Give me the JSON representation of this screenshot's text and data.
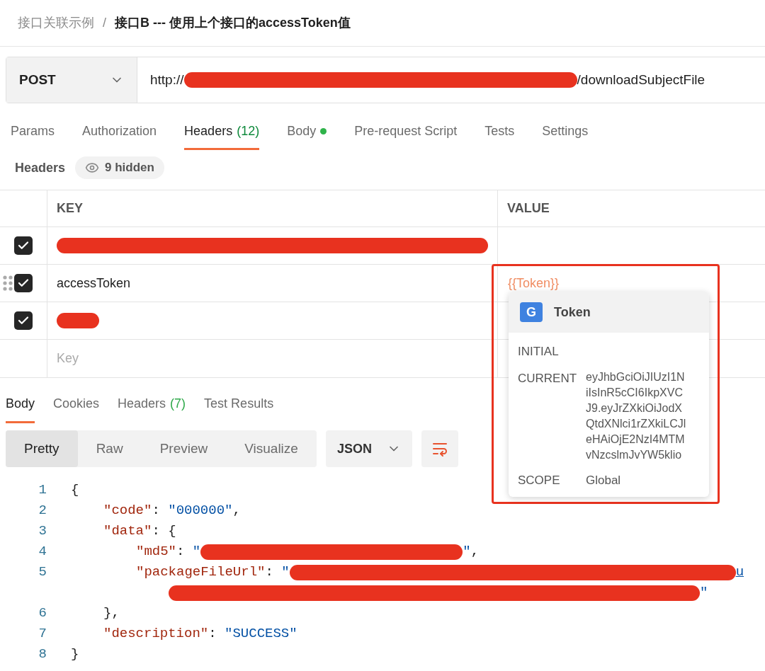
{
  "breadcrumb": {
    "parent": "接口关联示例",
    "separator": "/",
    "current": "接口B --- 使用上个接口的accessToken值"
  },
  "request": {
    "method": "POST",
    "url_prefix": "http://",
    "url_suffix": "/downloadSubjectFile"
  },
  "tabs": [
    {
      "label": "Params",
      "selected": false
    },
    {
      "label": "Authorization",
      "selected": false
    },
    {
      "label": "Headers",
      "badge": "(12)",
      "selected": true
    },
    {
      "label": "Body",
      "dot": true,
      "selected": false
    },
    {
      "label": "Pre-request Script",
      "selected": false
    },
    {
      "label": "Tests",
      "selected": false
    },
    {
      "label": "Settings",
      "selected": false
    }
  ],
  "headers_bar": {
    "title": "Headers",
    "hidden_badge": "9 hidden"
  },
  "table": {
    "columns": [
      "KEY",
      "VALUE"
    ],
    "rows": [
      {
        "kind": "masked",
        "checked": true
      },
      {
        "kind": "variable",
        "checked": true,
        "drag_handle": true,
        "key": "accessToken",
        "value": "{{Token}}"
      },
      {
        "kind": "masked",
        "checked": true
      },
      {
        "kind": "new",
        "placeholder": "Key"
      }
    ]
  },
  "popover": {
    "badge": "G",
    "name": "Token",
    "fields": [
      {
        "label": "INITIAL"
      },
      {
        "label": "CURRENT",
        "lines": [
          "eyJhbGciOiJIUzI1N",
          "iIsInR5cCI6IkpXVC",
          "J9.eyJrZXkiOiJodX",
          "QtdXNlci1rZXkiLCJl",
          "eHAiOjE2NzI4MTM",
          "vNzcslmJvYW5klio"
        ]
      },
      {
        "label": "SCOPE",
        "value": "Global"
      }
    ]
  },
  "response": {
    "tabs": [
      {
        "label": "Body",
        "selected": true
      },
      {
        "label": "Cookies",
        "selected": false
      },
      {
        "label": "Headers",
        "badge": "(7)",
        "selected": false
      },
      {
        "label": "Test Results",
        "selected": false
      }
    ],
    "view_modes": [
      {
        "label": "Pretty",
        "selected": true
      },
      {
        "label": "Raw",
        "selected": false
      },
      {
        "label": "Preview",
        "selected": false
      },
      {
        "label": "Visualize",
        "selected": false
      }
    ],
    "format": "JSON",
    "code": [
      {
        "number": "1",
        "kind": "outer",
        "tokens": [
          {
            "kind": "punct",
            "text": "{"
          }
        ]
      },
      {
        "number": "2",
        "kind": "inner",
        "tokens": [
          {
            "kind": "key",
            "text": "\"code\""
          },
          {
            "kind": "punct",
            "text": ": "
          },
          {
            "kind": "string",
            "text": "\"000000\""
          },
          {
            "kind": "punct",
            "text": ","
          }
        ]
      },
      {
        "number": "3",
        "kind": "inner",
        "tokens": [
          {
            "kind": "key",
            "text": "\"data\""
          },
          {
            "kind": "punct",
            "text": ": {"
          }
        ]
      },
      {
        "number": "4",
        "kind": "nested",
        "tokens": [
          {
            "kind": "key",
            "text": "\"md5\""
          },
          {
            "kind": "punct",
            "text": ": "
          },
          {
            "kind": "string",
            "text": "\""
          },
          {
            "kind": "mask"
          },
          {
            "kind": "string",
            "text": "\""
          },
          {
            "kind": "punct",
            "text": ","
          }
        ]
      },
      {
        "number": "5",
        "kind": "nested",
        "tokens": [
          {
            "kind": "key",
            "text": "\"packageFileUrl\""
          },
          {
            "kind": "punct",
            "text": ": "
          },
          {
            "kind": "string",
            "text": "\""
          },
          {
            "kind": "mask"
          },
          {
            "kind": "link",
            "text": "u"
          }
        ]
      },
      {
        "kind": "wrapped",
        "tokens": [
          {
            "kind": "mask"
          },
          {
            "kind": "string",
            "text": "\""
          }
        ]
      },
      {
        "number": "6",
        "kind": "inner",
        "tokens": [
          {
            "kind": "punct",
            "text": "},"
          }
        ]
      },
      {
        "number": "7",
        "kind": "inner",
        "tokens": [
          {
            "kind": "key",
            "text": "\"description\""
          },
          {
            "kind": "punct",
            "text": ": "
          },
          {
            "kind": "string",
            "text": "\"SUCCESS\""
          }
        ]
      },
      {
        "number": "8",
        "kind": "outer",
        "tokens": [
          {
            "kind": "punct",
            "text": "}"
          }
        ]
      }
    ]
  }
}
